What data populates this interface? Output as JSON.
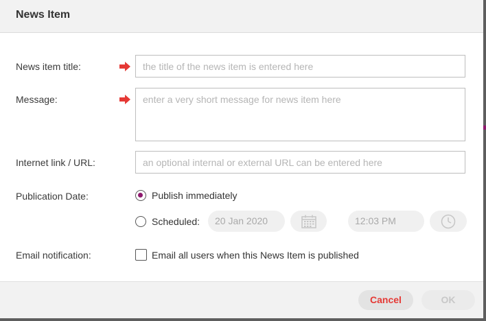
{
  "dialog": {
    "title": "News Item"
  },
  "form": {
    "title_label": "News item title:",
    "title_placeholder": "the title of the news item is entered here",
    "message_label": "Message:",
    "message_placeholder": "enter a very short message for news item here",
    "url_label": "Internet link / URL:",
    "url_placeholder": "an optional internal or external URL can be entered here",
    "pubdate_label": "Publication Date:",
    "publish_immediately_label": "Publish immediately",
    "publish_immediately_selected": true,
    "scheduled_label": "Scheduled:",
    "scheduled_selected": false,
    "scheduled_date": "20 Jan 2020",
    "scheduled_time": "12:03 PM",
    "email_label": "Email notification:",
    "email_checkbox_label": "Email all users when this News Item is published",
    "email_checked": false
  },
  "footer": {
    "cancel_label": "Cancel",
    "ok_label": "OK"
  },
  "colors": {
    "accent": "#8e1a6e",
    "required_arrow": "#e53935",
    "cancel_text": "#e53935"
  },
  "icons": {
    "required": "arrow-right-icon",
    "date": "calendar-icon",
    "time": "clock-icon"
  }
}
